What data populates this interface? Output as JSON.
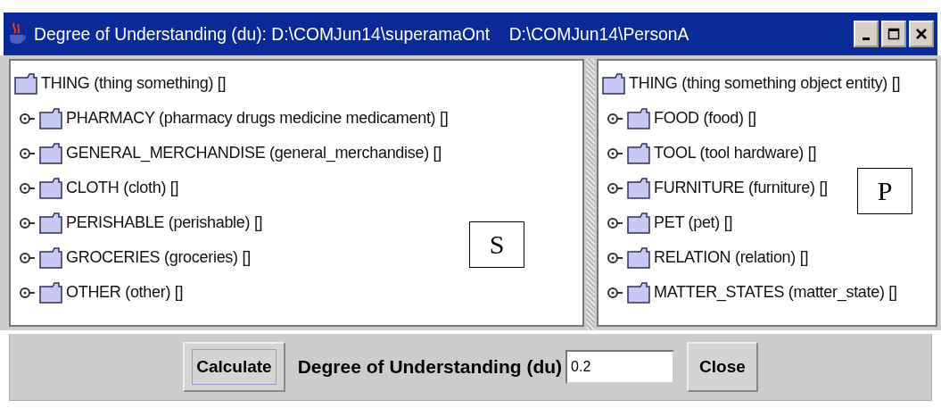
{
  "window": {
    "title": "Degree of Understanding (du): D:\\COMJun14\\superamaOnt    D:\\COMJun14\\PersonA"
  },
  "panels": [
    {
      "label": "S",
      "tree": {
        "text": "THING (thing something) []",
        "children": [
          {
            "text": "PHARMACY (pharmacy drugs medicine medicament) []",
            "expanded": false
          },
          {
            "text": "GENERAL_MERCHANDISE (general_merchandise) []",
            "expanded": false
          },
          {
            "text": "CLOTH (cloth) []",
            "expanded": false
          },
          {
            "text": "PERISHABLE (perishable) []",
            "expanded": false
          },
          {
            "text": "GROCERIES (groceries) []",
            "expanded": false
          },
          {
            "text": "OTHER (other) []",
            "expanded": false
          }
        ]
      }
    },
    {
      "label": "P",
      "tree": {
        "text": "THING (thing something object entity) []",
        "children": [
          {
            "text": "FOOD (food) []",
            "expanded": false
          },
          {
            "text": "TOOL (tool hardware) []",
            "expanded": false
          },
          {
            "text": "FURNITURE (furniture) []",
            "expanded": false
          },
          {
            "text": "PET (pet) []",
            "expanded": false
          },
          {
            "text": "RELATION (relation) []",
            "expanded": false
          },
          {
            "text": "MATTER_STATES (matter_state) []",
            "expanded": false
          }
        ]
      }
    }
  ],
  "bottom": {
    "calculate": {
      "label": "Calculate",
      "focused": true
    },
    "du_label": "Degree of Understanding (du)",
    "du_value": "0.2",
    "close": "Close"
  }
}
